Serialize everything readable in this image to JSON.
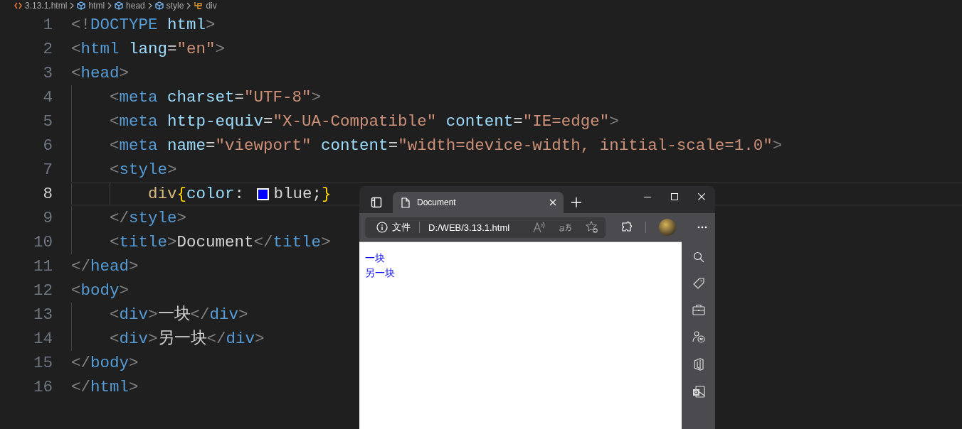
{
  "breadcrumb": [
    {
      "label": "3.13.1.html",
      "kind": "file"
    },
    {
      "label": "html",
      "kind": "element"
    },
    {
      "label": "head",
      "kind": "element"
    },
    {
      "label": "style",
      "kind": "element"
    },
    {
      "label": "div",
      "kind": "rule"
    }
  ],
  "editor": {
    "lines": [
      {
        "number": "1",
        "current": false,
        "tokens": [
          {
            "kind": "punct",
            "text": "<!"
          },
          {
            "kind": "tag",
            "text": "DOCTYPE"
          },
          {
            "kind": "attr",
            "text": " html"
          },
          {
            "kind": "punct",
            "text": ">"
          }
        ]
      },
      {
        "number": "2",
        "current": false,
        "tokens": [
          {
            "kind": "punct",
            "text": "<"
          },
          {
            "kind": "tag",
            "text": "html"
          },
          {
            "kind": "attr",
            "text": " lang"
          },
          {
            "kind": "plain",
            "text": "="
          },
          {
            "kind": "string",
            "text": "\"en\""
          },
          {
            "kind": "punct",
            "text": ">"
          }
        ]
      },
      {
        "number": "3",
        "current": false,
        "tokens": [
          {
            "kind": "punct",
            "text": "<"
          },
          {
            "kind": "tag",
            "text": "head"
          },
          {
            "kind": "punct",
            "text": ">"
          }
        ]
      },
      {
        "number": "4",
        "current": false,
        "tokens": [
          {
            "kind": "punct",
            "text": "    <"
          },
          {
            "kind": "tag",
            "text": "meta"
          },
          {
            "kind": "attr",
            "text": " charset"
          },
          {
            "kind": "plain",
            "text": "="
          },
          {
            "kind": "string",
            "text": "\"UTF-8\""
          },
          {
            "kind": "punct",
            "text": ">"
          }
        ]
      },
      {
        "number": "5",
        "current": false,
        "tokens": [
          {
            "kind": "punct",
            "text": "    <"
          },
          {
            "kind": "tag",
            "text": "meta"
          },
          {
            "kind": "attr",
            "text": " http-equiv"
          },
          {
            "kind": "plain",
            "text": "="
          },
          {
            "kind": "string",
            "text": "\"X-UA-Compatible\""
          },
          {
            "kind": "attr",
            "text": " content"
          },
          {
            "kind": "plain",
            "text": "="
          },
          {
            "kind": "string",
            "text": "\"IE=edge\""
          },
          {
            "kind": "punct",
            "text": ">"
          }
        ]
      },
      {
        "number": "6",
        "current": false,
        "tokens": [
          {
            "kind": "punct",
            "text": "    <"
          },
          {
            "kind": "tag",
            "text": "meta"
          },
          {
            "kind": "attr",
            "text": " name"
          },
          {
            "kind": "plain",
            "text": "="
          },
          {
            "kind": "string",
            "text": "\"viewport\""
          },
          {
            "kind": "attr",
            "text": " content"
          },
          {
            "kind": "plain",
            "text": "="
          },
          {
            "kind": "string",
            "text": "\"width=device-width, initial-scale=1.0\""
          },
          {
            "kind": "punct",
            "text": ">"
          }
        ]
      },
      {
        "number": "7",
        "current": false,
        "tokens": [
          {
            "kind": "punct",
            "text": "    <"
          },
          {
            "kind": "tag",
            "text": "style"
          },
          {
            "kind": "punct",
            "text": ">"
          }
        ]
      },
      {
        "number": "8",
        "current": true,
        "tokens": [
          {
            "kind": "selector",
            "text": "        div"
          },
          {
            "kind": "brace",
            "text": "{"
          },
          {
            "kind": "attr",
            "text": "color"
          },
          {
            "kind": "plain",
            "text": ": "
          },
          {
            "kind": "swatch",
            "color": "#0000ff"
          },
          {
            "kind": "plain",
            "text": "blue;"
          },
          {
            "kind": "brace",
            "text": "}"
          }
        ]
      },
      {
        "number": "9",
        "current": false,
        "tokens": [
          {
            "kind": "punct",
            "text": "    </"
          },
          {
            "kind": "tag",
            "text": "style"
          },
          {
            "kind": "punct",
            "text": ">"
          }
        ]
      },
      {
        "number": "10",
        "current": false,
        "tokens": [
          {
            "kind": "punct",
            "text": "    <"
          },
          {
            "kind": "tag",
            "text": "title"
          },
          {
            "kind": "punct",
            "text": ">"
          },
          {
            "kind": "plain",
            "text": "Document"
          },
          {
            "kind": "punct",
            "text": "</"
          },
          {
            "kind": "tag",
            "text": "title"
          },
          {
            "kind": "punct",
            "text": ">"
          }
        ]
      },
      {
        "number": "11",
        "current": false,
        "tokens": [
          {
            "kind": "punct",
            "text": "</"
          },
          {
            "kind": "tag",
            "text": "head"
          },
          {
            "kind": "punct",
            "text": ">"
          }
        ]
      },
      {
        "number": "12",
        "current": false,
        "tokens": [
          {
            "kind": "punct",
            "text": "<"
          },
          {
            "kind": "tag",
            "text": "body"
          },
          {
            "kind": "punct",
            "text": ">"
          }
        ]
      },
      {
        "number": "13",
        "current": false,
        "tokens": [
          {
            "kind": "punct",
            "text": "    <"
          },
          {
            "kind": "tag",
            "text": "div"
          },
          {
            "kind": "punct",
            "text": ">"
          },
          {
            "kind": "plain",
            "text": "一块"
          },
          {
            "kind": "punct",
            "text": "</"
          },
          {
            "kind": "tag",
            "text": "div"
          },
          {
            "kind": "punct",
            "text": ">"
          }
        ]
      },
      {
        "number": "14",
        "current": false,
        "tokens": [
          {
            "kind": "punct",
            "text": "    <"
          },
          {
            "kind": "tag",
            "text": "div"
          },
          {
            "kind": "punct",
            "text": ">"
          },
          {
            "kind": "plain",
            "text": "另一块"
          },
          {
            "kind": "punct",
            "text": "</"
          },
          {
            "kind": "tag",
            "text": "div"
          },
          {
            "kind": "punct",
            "text": ">"
          }
        ]
      },
      {
        "number": "15",
        "current": false,
        "tokens": [
          {
            "kind": "punct",
            "text": "</"
          },
          {
            "kind": "tag",
            "text": "body"
          },
          {
            "kind": "punct",
            "text": ">"
          }
        ]
      },
      {
        "number": "16",
        "current": false,
        "tokens": [
          {
            "kind": "punct",
            "text": "</"
          },
          {
            "kind": "tag",
            "text": "html"
          },
          {
            "kind": "punct",
            "text": ">"
          }
        ]
      }
    ]
  },
  "browser": {
    "tab": {
      "title": "Document",
      "selected": true
    },
    "address": {
      "security_label": "文件",
      "url": "D:/WEB/3.13.1.html"
    },
    "page": {
      "lines": [
        "一块",
        "另一块"
      ]
    }
  }
}
